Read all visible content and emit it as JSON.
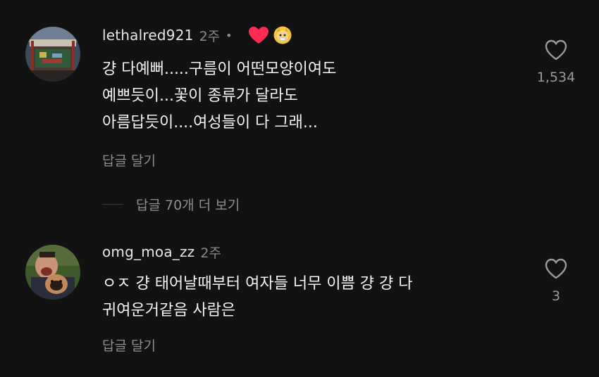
{
  "comments": [
    {
      "username": "lethalred921",
      "time": "2주",
      "dot": "•",
      "lines": [
        "걍 다예뻐.....구름이 어떤모양이여도",
        "예쁘듯이...꽃이 종류가 달라도",
        "아름답듯이....여성들이 다 그래..."
      ],
      "reply_label": "답글 달기",
      "like_count": "1,534",
      "creator_liked": true
    },
    {
      "username": "omg_moa_zz",
      "time": "2주",
      "lines": [
        "ㅇㅈ 걍 태어날때부터 여자들 너무 이쁨 걍 걍 다",
        "귀여운거같음 사람은"
      ],
      "reply_label": "답글 달기",
      "like_count": "3",
      "creator_liked": false
    }
  ],
  "view_replies_label": "답글 70개 더 보기",
  "colors": {
    "background": "#121212",
    "heart_red": "#fe2c55",
    "muted": "#8e8e8e"
  },
  "icons": {
    "like": "heart-outline-icon",
    "creator_like": "heart-filled-icon",
    "creator_badge": "creator-avatar-badge"
  }
}
